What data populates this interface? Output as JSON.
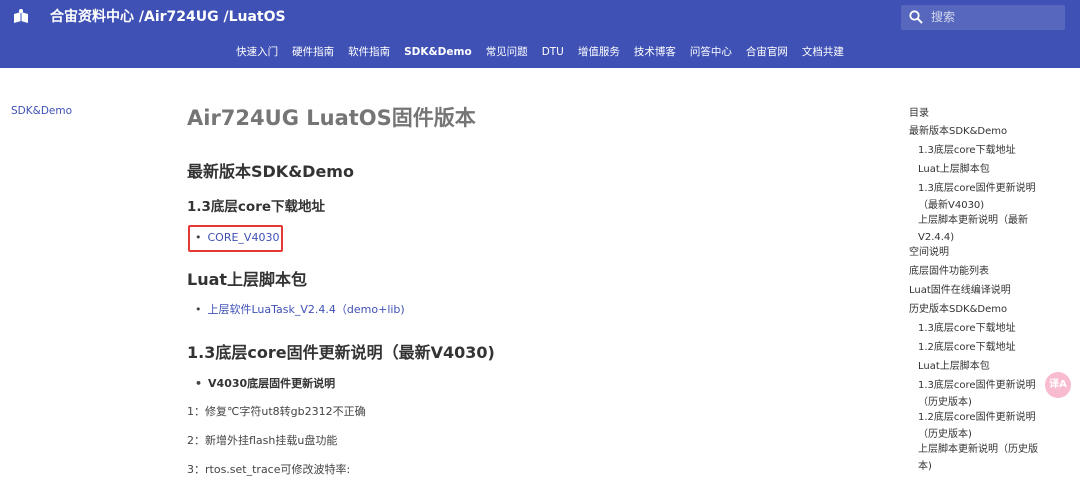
{
  "header": {
    "site_title": "合宙资料中心 /Air724UG /LuatOS",
    "search_placeholder": "搜索",
    "brand_color": "#3f51b5",
    "nav": [
      {
        "label": "快速入门"
      },
      {
        "label": "硬件指南"
      },
      {
        "label": "软件指南"
      },
      {
        "label": "SDK&Demo",
        "active": true
      },
      {
        "label": "常见问题"
      },
      {
        "label": "DTU"
      },
      {
        "label": "增值服务"
      },
      {
        "label": "技术博客"
      },
      {
        "label": "问答中心"
      },
      {
        "label": "合宙官网"
      },
      {
        "label": "文档共建"
      }
    ]
  },
  "sidebar": {
    "link": "SDK&Demo"
  },
  "content": {
    "page_title": "Air724UG LuatOS固件版本",
    "section_latest": "最新版本SDK&Demo",
    "sub_core": "1.3底层core下载地址",
    "core_link": "CORE_V4030",
    "sub_luat": "Luat上层脚本包",
    "luat_link": "上层软件LuaTask_V2.4.4（demo+lib)",
    "sub_update": "1.3底层core固件更新说明（最新V4030)",
    "update_bullet": "V4030底层固件更新说明",
    "items": [
      "1：修复℃字符ut8转gb2312不正确",
      "2：新增外挂flash挂载u盘功能",
      "3：rtos.set_trace可修改波特率:"
    ]
  },
  "toc": {
    "title": "目录",
    "items": [
      {
        "label": "最新版本SDK&Demo",
        "level": 1
      },
      {
        "label": "1.3底层core下载地址",
        "level": 2
      },
      {
        "label": "Luat上层脚本包",
        "level": 2
      },
      {
        "label": "1.3底层core固件更新说明（最新V4030)",
        "level": 2
      },
      {
        "label": "上层脚本更新说明（最新V2.4.4)",
        "level": 2
      },
      {
        "label": "空间说明",
        "level": 1
      },
      {
        "label": "底层固件功能列表",
        "level": 1
      },
      {
        "label": "Luat固件在线编译说明",
        "level": 1
      },
      {
        "label": "历史版本SDK&Demo",
        "level": 1
      },
      {
        "label": "1.3底层core下载地址",
        "level": 2
      },
      {
        "label": "1.2底层core下载地址",
        "level": 2
      },
      {
        "label": "Luat上层脚本包",
        "level": 2
      },
      {
        "label": "1.3底层core固件更新说明（历史版本)",
        "level": 2
      },
      {
        "label": "1.2底层core固件更新说明（历史版本)",
        "level": 2
      },
      {
        "label": "上层脚本更新说明（历史版本)",
        "level": 2
      }
    ]
  },
  "float_button": {
    "icon": "translate-icon",
    "label": "译A"
  }
}
